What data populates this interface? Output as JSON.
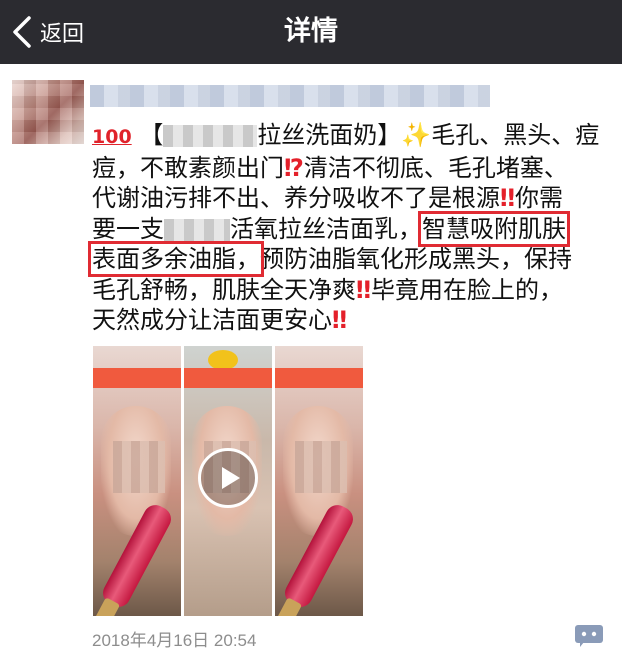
{
  "nav": {
    "back_label": "返回",
    "title": "详情"
  },
  "post": {
    "line1_prefix": "【",
    "line1_suffix": "拉丝洗面奶】",
    "line1_tail": "毛孔、黑头、痘",
    "line2_a": "痘，不敢素颜出门",
    "line2_b": "清洁不彻底、毛孔堵塞、",
    "line3_a": "代谢油污排不出、养分吸收不了是根源",
    "line3_b": "你需",
    "line4_a": "要一支",
    "line4_b": "活氧拉丝洁面乳，",
    "line4_hl": "智慧吸附肌肤",
    "line5_hl": "表面多余油脂，",
    "line5_b": "预防油脂氧化形成黑头，保持",
    "line6_a": "毛孔舒畅，肌肤全天净爽",
    "line6_b": "毕竟用在脸上的，",
    "line7_a": "天然成分让洁面更安心",
    "emoji_100": "100",
    "mark_double_exclaim": "‼",
    "mark_exclaim_question": "⁉",
    "sparkle": "✨"
  },
  "media": {
    "play_icon": "play-icon"
  },
  "meta": {
    "timestamp": "2018年4月16日 20:54"
  },
  "colors": {
    "navbar": "#2b2b30",
    "highlight_box": "#e02b33",
    "timestamp": "#8d8d8d",
    "link_blue": "#576b95"
  }
}
